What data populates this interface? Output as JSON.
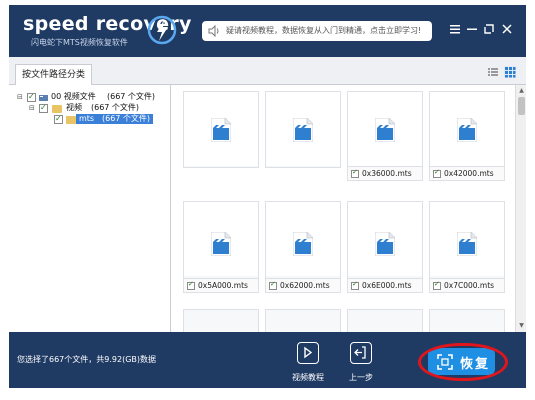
{
  "app": {
    "logo_text": "speed recovery",
    "subtitle": "闪电蛇下MTS视频恢复软件",
    "notice": "疑请视频教程，数据恢复从入门到精通，点击立即学习!",
    "window_controls": [
      "menu-icon",
      "minimize-icon",
      "restore-icon",
      "close-icon"
    ]
  },
  "tabs": {
    "active_label": "按文件路径分类"
  },
  "tree": {
    "root": {
      "label": "00 视频文件",
      "count": "(667 个文件)"
    },
    "child": {
      "label": "视频",
      "count": "(667 个文件)"
    },
    "leaf": {
      "label": "mts",
      "count": "(667 个文件)"
    }
  },
  "files": {
    "row1": [
      "",
      "",
      "0x36000.mts",
      "0x42000.mts"
    ],
    "row2": [
      "0x5A000.mts",
      "0x62000.mts",
      "0x6E000.mts",
      "0x7C000.mts"
    ]
  },
  "footer": {
    "status": "您选择了667个文件，共9.92(GB)数据",
    "video_tutorial": "视频教程",
    "previous": "上一步",
    "recover": "恢复"
  },
  "colors": {
    "frame": "#1f3a63",
    "recover_button": "#1e8fe3",
    "highlight_ring": "#e0161c",
    "file_icon": "#2f7fd0"
  }
}
